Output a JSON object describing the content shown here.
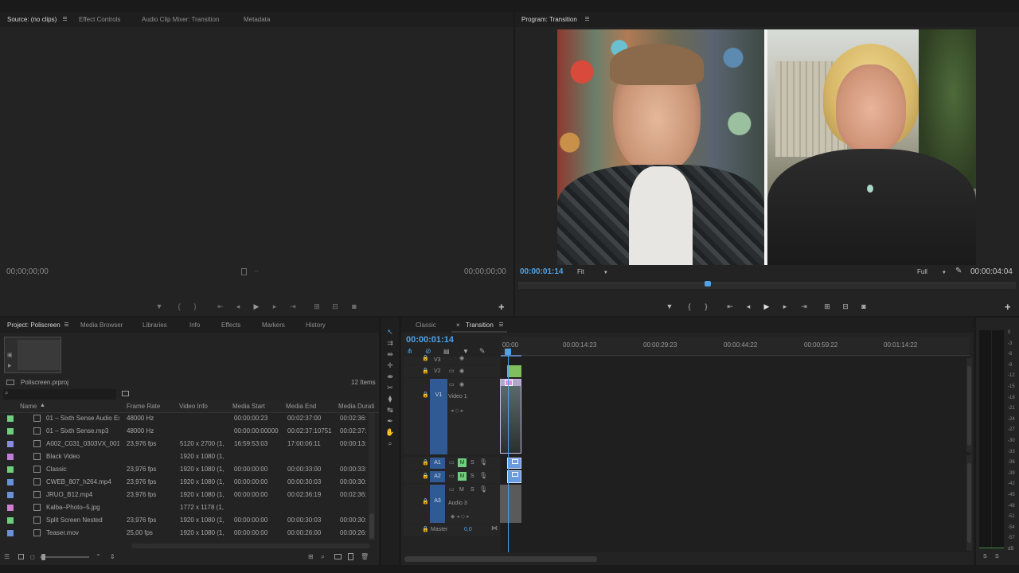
{
  "source_panel": {
    "tabs": [
      {
        "label": "Source: (no clips)",
        "active": true
      },
      {
        "label": "Effect Controls",
        "active": false
      },
      {
        "label": "Audio Clip Mixer: Transition",
        "active": false
      },
      {
        "label": "Metadata",
        "active": false
      }
    ],
    "timecode_in": "00;00;00;00",
    "timecode_out": "00;00;00;00"
  },
  "program_panel": {
    "tab": "Program: Transition",
    "current_time": "00:00:01:14",
    "fit_label": "Fit",
    "quality_label": "Full",
    "duration": "00:00:04:04",
    "playhead_fraction": 0.38
  },
  "project_panel": {
    "tabs": [
      {
        "label": "Project: Poliscreen",
        "active": true
      },
      {
        "label": "Media Browser",
        "active": false
      },
      {
        "label": "Libraries",
        "active": false
      },
      {
        "label": "Info",
        "active": false
      },
      {
        "label": "Effects",
        "active": false
      },
      {
        "label": "Markers",
        "active": false
      },
      {
        "label": "History",
        "active": false
      }
    ],
    "project_file": "Poliscreen.prproj",
    "item_count": "12 Items",
    "columns": [
      "Name",
      "Frame Rate",
      "Video Info",
      "Media Start",
      "Media End",
      "Media Durati"
    ],
    "rows": [
      {
        "color": "#6fcf7f",
        "name": "01 – Sixth Sense Audio Ex",
        "rate": "48000 Hz",
        "info": "",
        "start": "00:00:00:23",
        "end": "00:02:37:00",
        "dur": "00:02:36:"
      },
      {
        "color": "#6fcf7f",
        "name": "01 – Sixth Sense.mp3",
        "rate": "48000 Hz",
        "info": "",
        "start": "00:00:00:00000",
        "end": "00:02:37:10751",
        "dur": "00:02:37:"
      },
      {
        "color": "#8a8adf",
        "name": "A002_C031_0303VX_001.",
        "rate": "23,976 fps",
        "info": "5120 x 2700 (1,",
        "start": "16:59:53:03",
        "end": "17:00:06:11",
        "dur": "00:00:13:"
      },
      {
        "color": "#c07ed8",
        "name": "Black Video",
        "rate": "",
        "info": "1920 x 1080 (1,",
        "start": "",
        "end": "",
        "dur": ""
      },
      {
        "color": "#6fcf7f",
        "name": "Classic",
        "rate": "23,976 fps",
        "info": "1920 x 1080 (1,",
        "start": "00:00:00:00",
        "end": "00:00:33:00",
        "dur": "00:00:33:"
      },
      {
        "color": "#6a90d8",
        "name": "CWEB_807_h264.mp4",
        "rate": "23,976 fps",
        "info": "1920 x 1080 (1,",
        "start": "00:00:00:00",
        "end": "00:00:30:03",
        "dur": "00:00:30:"
      },
      {
        "color": "#6a90d8",
        "name": "JRUO_B12.mp4",
        "rate": "23,976 fps",
        "info": "1920 x 1080 (1,",
        "start": "00:00:00:00",
        "end": "00:02:36:19",
        "dur": "00:02:36:"
      },
      {
        "color": "#d07ed0",
        "name": "Kalba–Photo–5.jpg",
        "rate": "",
        "info": "1772 x 1178 (1,",
        "start": "",
        "end": "",
        "dur": ""
      },
      {
        "color": "#6fcf7f",
        "name": "Split Screen Nested",
        "rate": "23,976 fps",
        "info": "1920 x 1080 (1,",
        "start": "00:00:00:00",
        "end": "00:00:30:03",
        "dur": "00:00:30:"
      },
      {
        "color": "#6a90d8",
        "name": "Teaser.mov",
        "rate": "25,00 fps",
        "info": "1920 x 1080 (1,",
        "start": "00:00:00:00",
        "end": "00:00:26:00",
        "dur": "00:00:26:"
      }
    ]
  },
  "timeline_panel": {
    "tabs": [
      {
        "label": "Classic",
        "active": false
      },
      {
        "label": "Transition",
        "active": true
      }
    ],
    "timecode": "00:00:01:14",
    "ruler": [
      "00:00",
      "00:00:14:23",
      "00:00:29:23",
      "00:00:44:22",
      "00:00:59:22",
      "00:01:14:22"
    ],
    "tracks": {
      "v3": "V3",
      "v2": "V2",
      "v1": "V1",
      "video1_name": "Video 1",
      "a1": "A1",
      "a2": "A2",
      "a3": "A3",
      "audio3_name": "Audio 3",
      "m": "M",
      "s": "S",
      "master": "Master",
      "master_value": "0,0"
    }
  },
  "meter": {
    "labels": [
      "0",
      "-3",
      "-6",
      "-9",
      "-12",
      "-15",
      "-18",
      "-21",
      "-24",
      "-27",
      "-30",
      "-33",
      "-36",
      "-39",
      "-42",
      "-45",
      "-48",
      "-51",
      "-54",
      "-57",
      "dB"
    ],
    "solo": [
      "S",
      "S"
    ]
  },
  "icons": {
    "colors": {
      "accent": "#4fa3e8",
      "audio_clip": "#6fcf7f",
      "target": "#2f5a94"
    }
  }
}
